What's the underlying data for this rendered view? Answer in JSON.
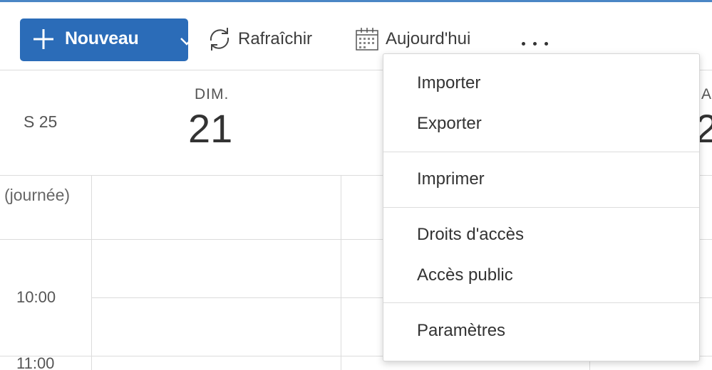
{
  "toolbar": {
    "new_label": "Nouveau",
    "refresh_label": "Rafraîchir",
    "today_label": "Aujourd'hui",
    "more_icon": "more-horizontal-icon"
  },
  "calendar": {
    "week_label": "S 25",
    "day_abbr": "DIM.",
    "day_number": "21",
    "next_day_abbr": "A",
    "next_day_number": "2",
    "allday_label": "(journée)",
    "times": [
      "10:00",
      "11:00"
    ]
  },
  "menu": {
    "items": [
      "Importer",
      "Exporter",
      "Imprimer",
      "Droits d'accès",
      "Accès public",
      "Paramètres"
    ]
  },
  "colors": {
    "accent": "#2b6cb8",
    "top_border": "#4a86c5",
    "grid": "#dcdcdc"
  }
}
